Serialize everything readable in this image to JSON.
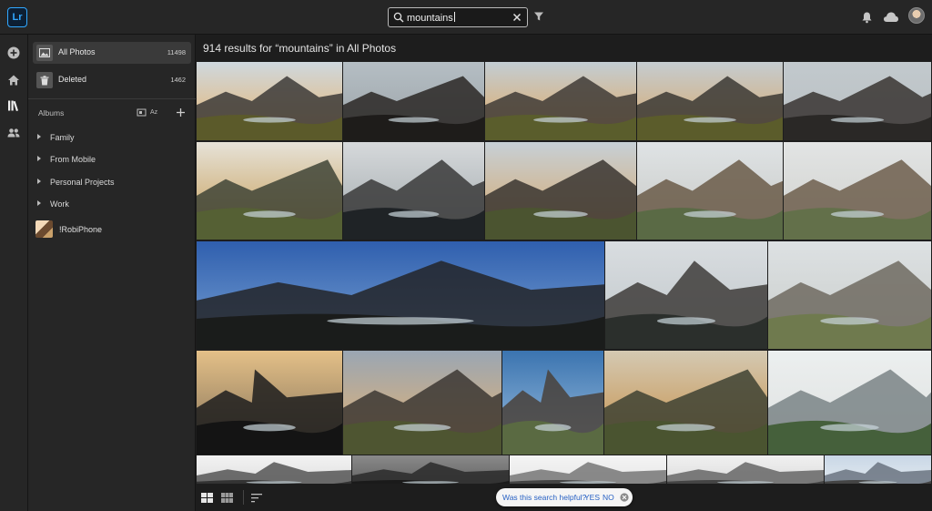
{
  "app": {
    "logo_text": "Lr"
  },
  "header": {
    "search_value": "mountains",
    "icons": [
      "search-icon",
      "clear-icon",
      "filter-icon",
      "bell-icon",
      "cloud-icon",
      "avatar"
    ]
  },
  "rail": {
    "icons": [
      "add-icon",
      "home-icon",
      "library-icon",
      "people-icon"
    ]
  },
  "sidebar": {
    "all_photos": {
      "label": "All Photos",
      "count": "11498"
    },
    "deleted": {
      "label": "Deleted",
      "count": "1462"
    },
    "albums_heading": "Albums",
    "albums_sort_label": "Az",
    "albums": [
      {
        "label": "Family"
      },
      {
        "label": "From Mobile"
      },
      {
        "label": "Personal Projects"
      },
      {
        "label": "Work"
      }
    ],
    "device": {
      "label": "!RobiPhone"
    }
  },
  "main": {
    "results_title": "914 results for “mountains” in All Photos"
  },
  "feedback": {
    "question": "Was this search helpful?",
    "yes": "YES",
    "no": "NO"
  },
  "colors": {
    "accent": "#31a8ff",
    "link": "#2962c4",
    "panel": "#262626",
    "background": "#1d1d1d"
  }
}
